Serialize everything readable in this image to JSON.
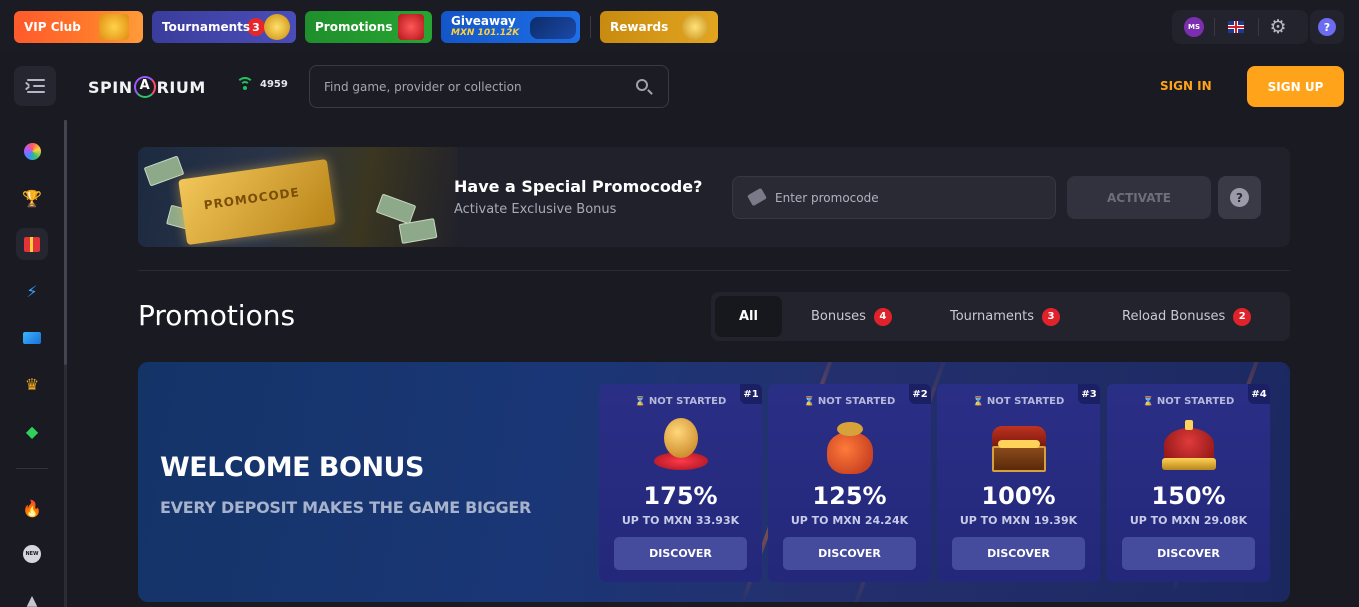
{
  "topbar": {
    "vip_label": "VIP Club",
    "tournaments_label": "Tournaments",
    "tournaments_badge": "3",
    "promotions_label": "Promotions",
    "giveaway_label": "Giveaway",
    "giveaway_amount": "MXN 101.12K",
    "rewards_label": "Rewards",
    "avatar_initials": "MS",
    "help_icon_char": "?"
  },
  "header": {
    "logo_left": "SPIN",
    "logo_right": "RIUM",
    "online_count": "4959",
    "search_placeholder": "Find game, provider or collection",
    "signin_label": "SIGN IN",
    "signup_label": "SIGN UP"
  },
  "sidebar": {
    "icons": [
      "casino-icon",
      "trophy-icon",
      "gift-icon",
      "lightning-icon",
      "cards-icon",
      "crown-icon",
      "diamond-icon",
      "flame-icon",
      "new-icon",
      "tent-icon"
    ],
    "new_label": "NEW"
  },
  "promocode": {
    "ticket_text": "PROMOCODE",
    "title": "Have a Special Promocode?",
    "subtitle": "Activate Exclusive Bonus",
    "input_placeholder": "Enter promocode",
    "activate_label": "ACTIVATE",
    "help_char": "?"
  },
  "promotions": {
    "title": "Promotions",
    "tabs": [
      {
        "label": "All",
        "count": ""
      },
      {
        "label": "Bonuses",
        "count": "4"
      },
      {
        "label": "Tournaments",
        "count": "3"
      },
      {
        "label": "Reload Bonuses",
        "count": "2"
      }
    ]
  },
  "welcome": {
    "title": "WELCOME BONUS",
    "subtitle": "EVERY DEPOSIT MAKES THE GAME BIGGER",
    "cards": [
      {
        "rank": "#1",
        "status": "NOT STARTED",
        "percent": "175%",
        "upto": "UP TO  MXN 33.93K",
        "button": "DISCOVER",
        "icon": "coin-icon"
      },
      {
        "rank": "#2",
        "status": "NOT STARTED",
        "percent": "125%",
        "upto": "UP TO  MXN 24.24K",
        "button": "DISCOVER",
        "icon": "money-bag-icon"
      },
      {
        "rank": "#3",
        "status": "NOT STARTED",
        "percent": "100%",
        "upto": "UP TO  MXN 19.39K",
        "button": "DISCOVER",
        "icon": "treasure-chest-icon"
      },
      {
        "rank": "#4",
        "status": "NOT STARTED",
        "percent": "150%",
        "upto": "UP TO  MXN 29.08K",
        "button": "DISCOVER",
        "icon": "crown-icon"
      }
    ]
  },
  "colors": {
    "accent": "#ffa31a",
    "badge_red": "#e0232a",
    "online_green": "#20c35c"
  }
}
